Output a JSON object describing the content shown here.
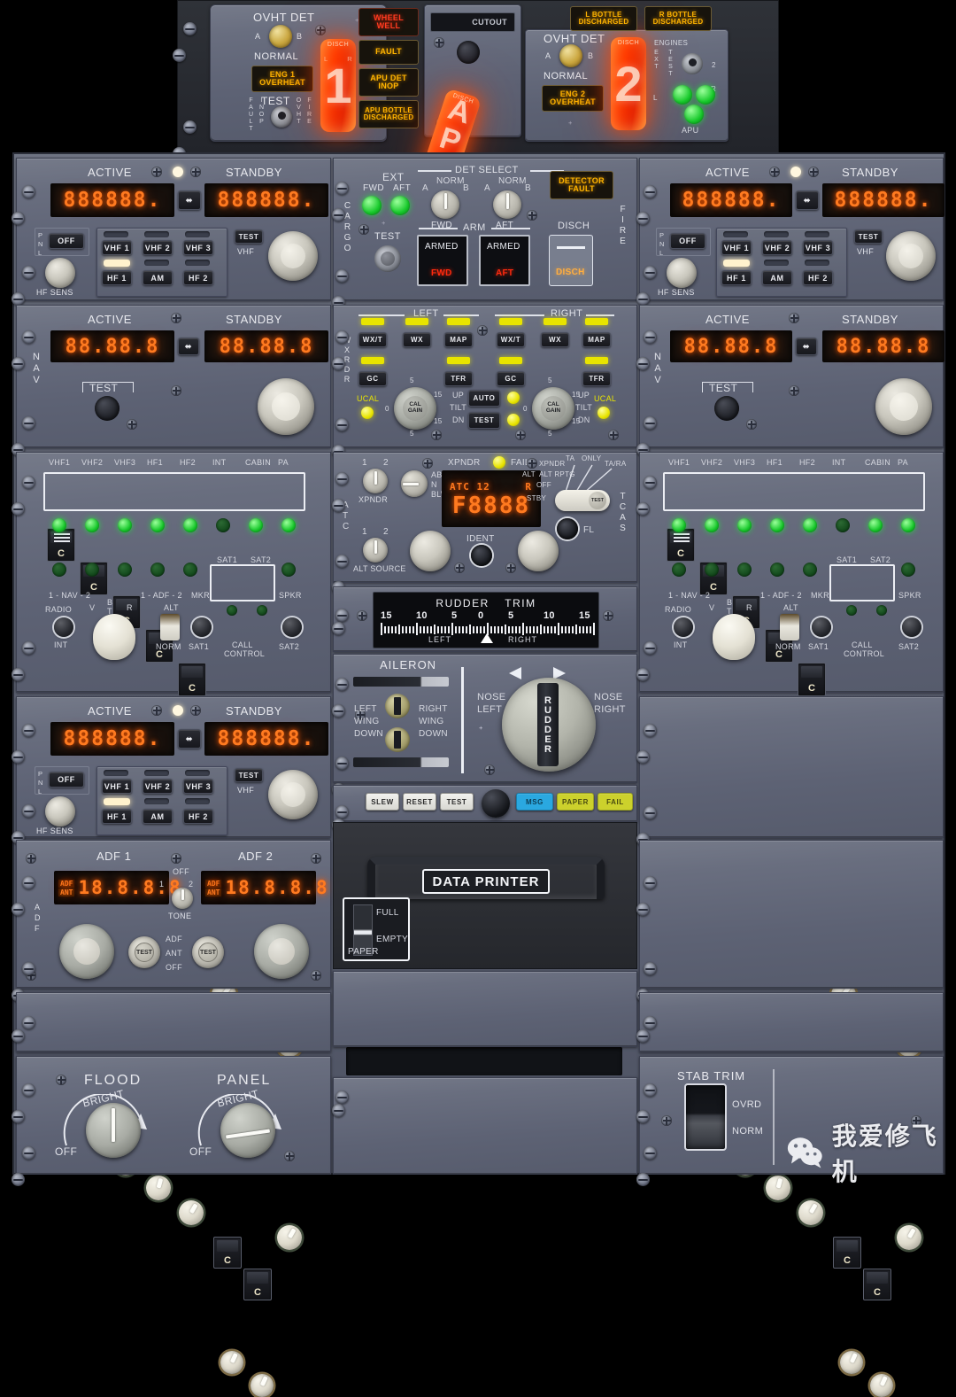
{
  "fire_panel": {
    "eng1": {
      "ovht_det_label": "OVHT DET",
      "sel_a": "A",
      "sel_b": "B",
      "normal": "NORMAL",
      "annunciator": "ENG 1\nOVERHEAT",
      "annun_line1": "ENG 1",
      "annun_line2": "OVERHEAT",
      "test_label": "TEST",
      "test_left": "FAULT/INOP",
      "test_left_1": "FAULT",
      "test_left_2": "INOP",
      "test_right_1": "OVHT",
      "test_right_2": "FIRE",
      "handle_number": "1",
      "handle_disch": "DISCH",
      "handle_l": "L",
      "handle_r": "R"
    },
    "center_annunciators": [
      {
        "line1": "WHEEL",
        "line2": "WELL",
        "color": "red"
      },
      {
        "line1": "FAULT",
        "line2": "",
        "color": "amber"
      },
      {
        "line1": "APU DET",
        "line2": "INOP",
        "color": "amber"
      },
      {
        "line1": "APU BOTTLE",
        "line2": "DISCHARGED",
        "color": "amber"
      }
    ],
    "apu": {
      "cutout_label": "CUTOUT",
      "handle_label": "APU",
      "handle_disch": "DISCH"
    },
    "eng2": {
      "ovht_det_label": "OVHT DET",
      "sel_a": "A",
      "sel_b": "B",
      "normal": "NORMAL",
      "annun_line1": "ENG 2",
      "annun_line2": "OVERHEAT",
      "handle_number": "2",
      "handle_disch": "DISCH"
    },
    "bottles": [
      {
        "line1": "L BOTTLE",
        "line2": "DISCHARGED"
      },
      {
        "line1": "R BOTTLE",
        "line2": "DISCHARGED"
      }
    ],
    "engines_block": {
      "engines": "ENGINES",
      "ext": "EXT",
      "test": "TEST",
      "l": "L",
      "r": "R",
      "two": "2",
      "apu": "APU"
    }
  },
  "radio_common": {
    "active": "ACTIVE",
    "standby": "STANDBY",
    "display_value": "888888.",
    "pnl": "PNL",
    "pnl_p": "P",
    "pnl_n": "N",
    "pnl_l": "L",
    "off": "OFF",
    "hf_sens": "HF SENS",
    "test": "TEST",
    "vhf": "VHF",
    "buttons_row1": [
      "VHF 1",
      "VHF 2",
      "VHF 3"
    ],
    "buttons_row2": [
      "HF 1",
      "AM",
      "HF 2"
    ]
  },
  "nav_panel": {
    "side_label": "NAV",
    "active": "ACTIVE",
    "standby": "STANDBY",
    "display_value": "88.88.8",
    "test": "TEST"
  },
  "cargo_fire": {
    "side_label_left": "CARGO",
    "side_label_right": "FIRE",
    "ext": "EXT",
    "fwd": "FWD",
    "aft": "AFT",
    "test": "TEST",
    "det_select": "DET SELECT",
    "norm": "NORM",
    "a": "A",
    "b": "B",
    "arm": "ARM",
    "armed": "ARMED",
    "armed_fwd": "FWD",
    "armed_aft": "AFT",
    "disch": "DISCH",
    "disch_btn": "DISCH",
    "detector_fault_1": "DETECTOR",
    "detector_fault_2": "FAULT"
  },
  "wxradar": {
    "side_label": "WXRDR",
    "left_title": "LEFT",
    "right_title": "RIGHT",
    "mode_buttons": [
      "WX/T",
      "WX",
      "MAP"
    ],
    "second_row": [
      "GC",
      "TFR"
    ],
    "cal_gain_1": "CAL",
    "cal_gain_2": "GAIN",
    "ucal": "UCAL",
    "tilt_up": "UP",
    "tilt": "TILT",
    "tilt_dn": "DN",
    "scale_0": "0",
    "scale_5": "5",
    "scale_15": "15",
    "auto": "AUTO",
    "test": "TEST"
  },
  "transponder": {
    "side_label_left_1": "A",
    "side_label_left_2": "T",
    "side_label_left_3": "C",
    "side_label_right": "TCAS",
    "xpndr_label": "XPNDR",
    "xpndr_1": "1",
    "xpndr_2": "2",
    "alt_source": "ALT SOURCE",
    "alt_1": "1",
    "alt_2": "2",
    "abv": "ABV",
    "n": "N",
    "blw": "BLW",
    "fail_label_left": "XPNDR",
    "fail_label_right": "FAIL",
    "display_header_left": "ATC 12",
    "display_header_right": "R",
    "display_value": "F8888",
    "ident": "IDENT",
    "fl": "FL",
    "tcas_modes": [
      "XPNDR",
      "ALT RPTG",
      "OFF",
      "STBY",
      "TA ONLY",
      "TA/RA"
    ],
    "tcas_xpndr": "XPNDR",
    "tcas_altrptg": "ALT RPTG",
    "tcas_off": "OFF",
    "tcas_stby": "STBY",
    "tcas_ta": "TA",
    "tcas_only": "ONLY",
    "tcas_tara": "TA/RA"
  },
  "audio_panel": {
    "columns": [
      "VHF1",
      "VHF2",
      "VHF3",
      "HF1",
      "HF2",
      "INT",
      "CABIN",
      "PA"
    ],
    "mic_char": "C",
    "row2_labels": [
      "1 - NAV - 2",
      "1 - ADF - 2",
      "MKR",
      "SPKR"
    ],
    "nav_label": "1 - NAV - 2",
    "adf_label": "1 - ADF - 2",
    "mkr": "MKR",
    "spkr": "SPKR",
    "sat1": "SAT1",
    "sat2": "SAT2",
    "radio": "RADIO",
    "int": "INT",
    "v": "V",
    "b": "B",
    "t": "T",
    "r": "R",
    "alt": "ALT",
    "norm": "NORM",
    "call_control_1": "CALL",
    "call_control_2": "CONTROL"
  },
  "rudder_trim": {
    "title_1": "RUDDER",
    "title_2": "TRIM",
    "ticks": [
      "15",
      "10",
      "5",
      "0",
      "5",
      "10",
      "15"
    ],
    "left": "LEFT",
    "right": "RIGHT",
    "value": 0
  },
  "aileron_trim": {
    "title": "AILERON",
    "left_wing_down": "LEFT\nWING\nDOWN",
    "lwd_1": "LEFT",
    "lwd_2": "WING",
    "lwd_3": "DOWN",
    "rwd_1": "RIGHT",
    "rwd_2": "WING",
    "rwd_3": "DOWN",
    "nose_left_1": "NOSE",
    "nose_left_2": "LEFT",
    "nose_right_1": "NOSE",
    "nose_right_2": "RIGHT",
    "rudder_knob": "RUDDER"
  },
  "printer": {
    "buttons": [
      "SLEW",
      "RESET",
      "TEST"
    ],
    "status": [
      {
        "label": "MSG",
        "color": "#2aa8e0"
      },
      {
        "label": "PAPER",
        "color": "#ccd12c"
      },
      {
        "label": "FAIL",
        "color": "#ccd12c"
      }
    ],
    "title": "DATA  PRINTER",
    "paper_full": "FULL",
    "paper_empty": "EMPTY",
    "paper_label": "PAPER"
  },
  "adf_panel": {
    "side_label_1": "A",
    "side_label_2": "D",
    "side_label_3": "F",
    "adf1": "ADF 1",
    "adf2": "ADF 2",
    "display_value": "18.8.8.8",
    "tag_adf": "ADF",
    "tag_ant": "ANT",
    "off": "OFF",
    "tone": "TONE",
    "sel_1": "1",
    "sel_2": "2",
    "test": "TEST",
    "mode_adf": "ADF",
    "mode_ant": "ANT",
    "mode_off": "OFF"
  },
  "lighting": {
    "flood": "FLOOD",
    "panel": "PANEL",
    "bright": "BRIGHT",
    "off": "OFF"
  },
  "stab_trim": {
    "title": "STAB TRIM",
    "ovrd": "OVRD",
    "norm": "NORM"
  },
  "watermark": {
    "text": "我爱修飞机",
    "icon": "wechat-icon"
  },
  "colors": {
    "panel_face": "#5d6274",
    "panel_dark": "#4b5062",
    "led_orange": "#ff7a20",
    "annun_amber": "#ffb400",
    "annun_red": "#ff3b20",
    "green_led": "#17c92b",
    "yellow_led": "#e8e400",
    "fire_red": "#ff3a00"
  }
}
